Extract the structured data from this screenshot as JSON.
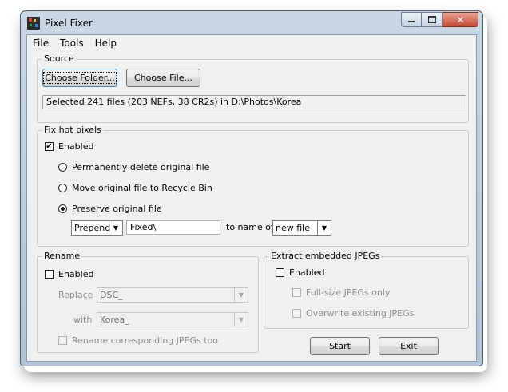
{
  "window": {
    "title": "Pixel Fixer",
    "minimize_icon": "minimize-icon",
    "maximize_icon": "maximize-icon",
    "close_icon": "close-icon"
  },
  "menu": [
    "File",
    "Tools",
    "Help"
  ],
  "source": {
    "title": "Source",
    "choose_folder": "Choose Folder...",
    "choose_file": "Choose File...",
    "status": "Selected 241 files (203 NEFs, 38 CR2s) in D:\\Photos\\Korea"
  },
  "hot_pixels": {
    "title": "Fix hot pixels",
    "enabled_label": "Enabled",
    "enabled_checked": "✔",
    "option_delete": "Permanently delete original file",
    "option_recycle": "Move original file to Recycle Bin",
    "option_preserve": "Preserve original file",
    "mode_value": "Prepend",
    "text_value": "Fixed\\",
    "to_name_of": "to name of",
    "target_value": "new file"
  },
  "rename": {
    "title": "Rename",
    "enabled_label": "Enabled",
    "replace_label": "Replace",
    "replace_value": "DSC_",
    "with_label": "with",
    "with_value": "Korea_",
    "jpeg_label": "Rename corresponding JPEGs too"
  },
  "extract": {
    "title": "Extract embedded JPEGs",
    "enabled_label": "Enabled",
    "fullsize_label": "Full-size JPEGs only",
    "overwrite_label": "Overwrite existing JPEGs"
  },
  "actions": {
    "start": "Start",
    "exit": "Exit"
  }
}
